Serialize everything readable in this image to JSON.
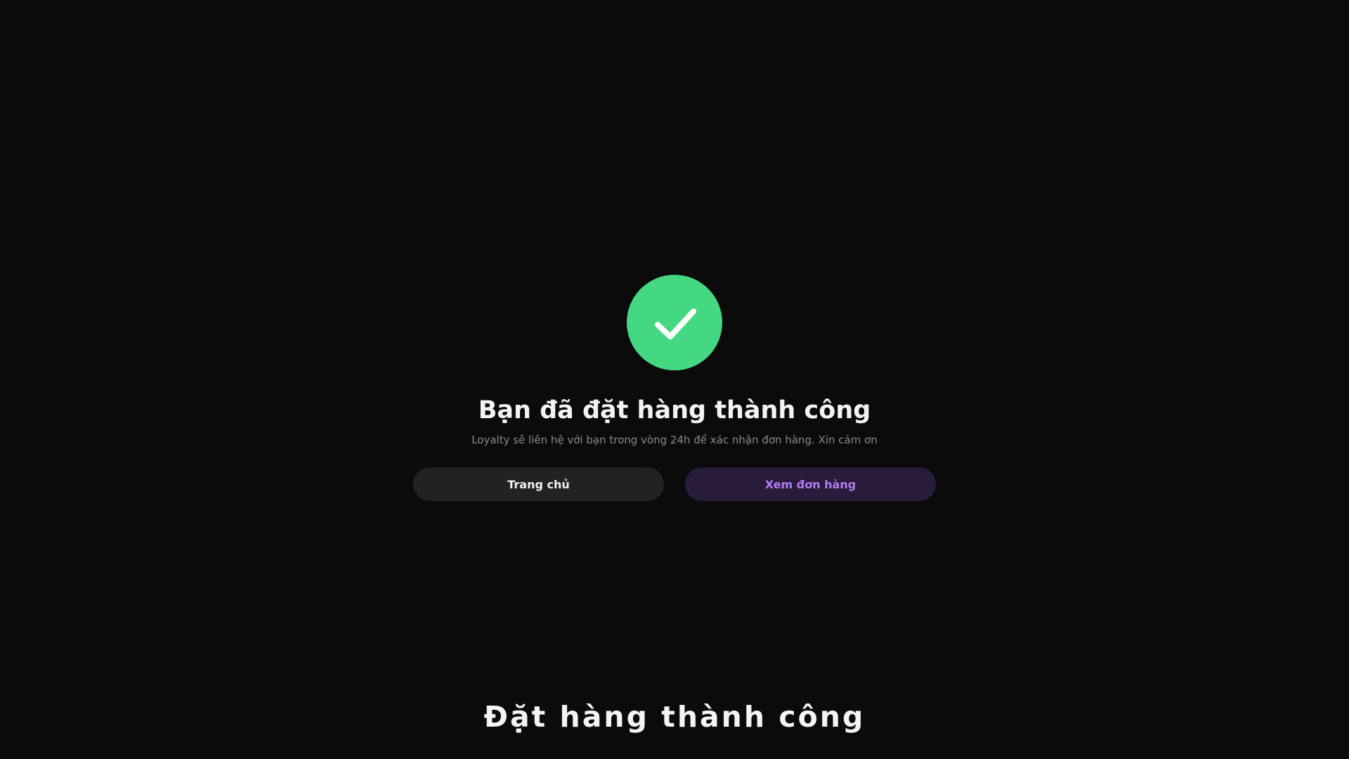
{
  "success": {
    "icon": "check-icon",
    "icon_color": "#45d882",
    "headline": "Bạn đã đặt hàng thành công",
    "message": "Loyalty sẽ liên hệ với bạn trong vòng 24h để xác nhận đơn hàng. Xin cảm ơn"
  },
  "actions": {
    "home_label": "Trang chủ",
    "orders_label": "Xem đơn hàng",
    "orders_accent": "#b47cf2"
  },
  "footer": {
    "title": "Đặt hàng thành công"
  }
}
